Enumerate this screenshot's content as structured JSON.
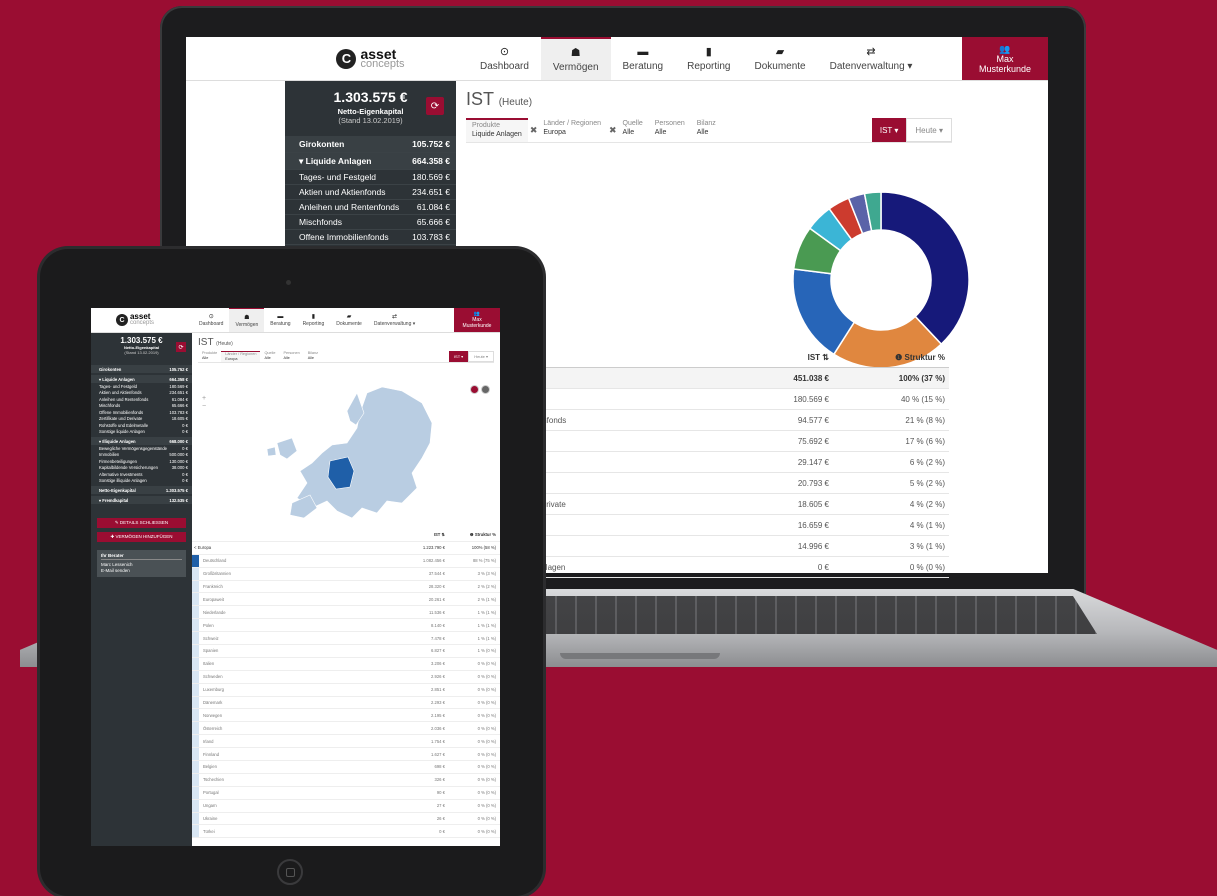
{
  "brand": {
    "name": "asset",
    "sub": "concepts"
  },
  "nav": [
    {
      "icon": "⊙",
      "label": "Dashboard"
    },
    {
      "icon": "☗",
      "label": "Vermögen"
    },
    {
      "icon": "▬",
      "label": "Beratung"
    },
    {
      "icon": "▮",
      "label": "Reporting"
    },
    {
      "icon": "▰",
      "label": "Dokumente"
    },
    {
      "icon": "⇄",
      "label": "Datenverwaltung ▾"
    }
  ],
  "user": {
    "icon": "👥",
    "first": "Max",
    "last": "Musterkunde"
  },
  "kpi": {
    "value": "1.303.575 €",
    "label": "Netto-Eigenkapital",
    "date": "(Stand 13.02.2019)",
    "refresh_icon": "⟳"
  },
  "laptop_sidebar": [
    {
      "label": "Girokonten",
      "value": "105.752 €",
      "type": "group"
    },
    {
      "label": "▾ Liquide Anlagen",
      "value": "664.358 €",
      "type": "group"
    },
    {
      "label": "Tages- und Festgeld",
      "value": "180.569 €"
    },
    {
      "label": "Aktien und Aktienfonds",
      "value": "234.651 €"
    },
    {
      "label": "Anleihen und Rentenfonds",
      "value": "61.084 €"
    },
    {
      "label": "Mischfonds",
      "value": "65.666 €"
    },
    {
      "label": "Offene Immobilienfonds",
      "value": "103.783 €"
    },
    {
      "label": "Zertifikate und Derivate",
      "value": "18.605 €"
    },
    {
      "label": "Rohstoffe und Edelmetalle",
      "value": "0 €"
    },
    {
      "label": "Sonstige liquide Anlagen",
      "value": "0 €"
    }
  ],
  "page": {
    "title": "IST",
    "subtitle": "(Heute)"
  },
  "filters": [
    {
      "label": "Produkte",
      "value": "Liquide Anlagen",
      "active": true,
      "removable": true
    },
    {
      "label": "Länder / Regionen",
      "value": "Europa",
      "active": false,
      "removable": true
    },
    {
      "label": "Quelle",
      "value": "Alle"
    },
    {
      "label": "Personen",
      "value": "Alle"
    },
    {
      "label": "Bilanz",
      "value": "Alle"
    }
  ],
  "ist_button": "IST ▾",
  "heute_button": "Heute ▾",
  "donut": {
    "colors": [
      "#16197a",
      "#e0873f",
      "#2765b8",
      "#4a9a52",
      "#3bb5d6",
      "#cc3b2e",
      "#5a63a8",
      "#3fa890"
    ],
    "values": [
      38,
      21,
      18,
      8,
      5,
      4,
      3,
      3
    ]
  },
  "laptop_table": {
    "headers": {
      "ist": "IST ⇅",
      "struktur": "❶ Struktur %"
    },
    "rows": [
      {
        "name": "",
        "ist": "451.038 €",
        "struktur": "100%  (37 %)",
        "total": true
      },
      {
        "name": "",
        "ist": "180.569 €",
        "struktur": "40 %  (15 %)"
      },
      {
        "name": "ienfonds",
        "ist": "94.577 €",
        "struktur": "21 %  (8 %)"
      },
      {
        "name": "",
        "ist": "75.692 €",
        "struktur": "17 %  (6 %)"
      },
      {
        "name": "",
        "ist": "29.147 €",
        "struktur": "6 %  (2 %)"
      },
      {
        "name": "",
        "ist": "20.793 €",
        "struktur": "5 %  (2 %)"
      },
      {
        "name": "Derivate",
        "ist": "18.605 €",
        "struktur": "4 %  (2 %)"
      },
      {
        "name": "",
        "ist": "16.659 €",
        "struktur": "4 %  (1 %)"
      },
      {
        "name": "",
        "ist": "14.996 €",
        "struktur": "3 %  (1 %)"
      },
      {
        "name": "Anlagen",
        "ist": "0 €",
        "struktur": "0 %  (0 %)"
      }
    ]
  },
  "tablet_sidebar": [
    {
      "label": "Girokonten",
      "value": "105.752 €",
      "type": "group"
    },
    {
      "label": "▾ Liquide Anlagen",
      "value": "664.358 €",
      "type": "group"
    },
    {
      "label": "Tages- und Festgeld",
      "value": "180.569 €"
    },
    {
      "label": "Aktien und Aktienfonds",
      "value": "234.651 €"
    },
    {
      "label": "Anleihen und Rentenfonds",
      "value": "61.084 €"
    },
    {
      "label": "Mischfonds",
      "value": "65.666 €"
    },
    {
      "label": "Offene Immobilienfonds",
      "value": "103.783 €"
    },
    {
      "label": "Zertifikate und Derivate",
      "value": "18.605 €"
    },
    {
      "label": "Rohstoffe und Edelmetalle",
      "value": "0 €"
    },
    {
      "label": "Sonstige liquide Anlagen",
      "value": "0 €"
    },
    {
      "label": "▾ Illiquide Anlagen",
      "value": "668.000 €",
      "type": "group"
    },
    {
      "label": "Bewegliche Vermögensgegenstände",
      "value": "0 €"
    },
    {
      "label": "Immobilien",
      "value": "500.000 €"
    },
    {
      "label": "Firmenbeteiligungen",
      "value": "130.000 €"
    },
    {
      "label": "Kapitalbildende Versicherungen",
      "value": "38.000 €"
    },
    {
      "label": "Alternative Investments",
      "value": "0 €"
    },
    {
      "label": "Sonstige illiquide Anlagen",
      "value": "0 €"
    },
    {
      "label": "Netto-Eigenkapital",
      "value": "1.303.575 €",
      "type": "group"
    },
    {
      "label": "▾ Fremdkapital",
      "value": "132.535 €",
      "type": "group"
    }
  ],
  "tablet_buttons": {
    "close": "✎  DETAILS SCHLIESSEN",
    "add": "✚  VERMÖGEN HINZUFÜGEN"
  },
  "berater": {
    "title": "Ihr Berater",
    "name": "Marc Lessenich",
    "mail": "E-Mail senden"
  },
  "zoom": {
    "in": "+",
    "out": "−"
  },
  "tablet_table": {
    "headers": {
      "ist": "IST ⇅",
      "struktur": "❶ Struktur %"
    },
    "total": {
      "name": "< Europa",
      "ist": "1.223.790 €",
      "struktur": "100%  (58 %)"
    },
    "rows": [
      {
        "name": "Deutschland",
        "ist": "1.082.456 €",
        "struktur": "88 %  (75 %)",
        "sel": true
      },
      {
        "name": "Großbritannien",
        "ist": "37.544 €",
        "struktur": "3 %  (3 %)"
      },
      {
        "name": "Frankreich",
        "ist": "28.320 €",
        "struktur": "2 %  (2 %)"
      },
      {
        "name": "Europaweit",
        "ist": "20.261 €",
        "struktur": "2 %  (1 %)"
      },
      {
        "name": "Niederlande",
        "ist": "11.536 €",
        "struktur": "1 %  (1 %)"
      },
      {
        "name": "Polen",
        "ist": "8.140 €",
        "struktur": "1 %  (1 %)"
      },
      {
        "name": "Schweiz",
        "ist": "7.478 €",
        "struktur": "1 %  (1 %)"
      },
      {
        "name": "Spanien",
        "ist": "6.827 €",
        "struktur": "1 %  (0 %)"
      },
      {
        "name": "Italien",
        "ist": "3.206 €",
        "struktur": "0 %  (0 %)"
      },
      {
        "name": "Schweden",
        "ist": "2.926 €",
        "struktur": "0 %  (0 %)"
      },
      {
        "name": "Luxemburg",
        "ist": "2.851 €",
        "struktur": "0 %  (0 %)"
      },
      {
        "name": "Dänemark",
        "ist": "2.293 €",
        "struktur": "0 %  (0 %)"
      },
      {
        "name": "Norwegen",
        "ist": "2.195 €",
        "struktur": "0 %  (0 %)"
      },
      {
        "name": "Österreich",
        "ist": "2.036 €",
        "struktur": "0 %  (0 %)"
      },
      {
        "name": "Irland",
        "ist": "1.754 €",
        "struktur": "0 %  (0 %)"
      },
      {
        "name": "Finnland",
        "ist": "1.627 €",
        "struktur": "0 %  (0 %)"
      },
      {
        "name": "Belgien",
        "ist": "698 €",
        "struktur": "0 %  (0 %)"
      },
      {
        "name": "Tschechien",
        "ist": "326 €",
        "struktur": "0 %  (0 %)"
      },
      {
        "name": "Portugal",
        "ist": "90 €",
        "struktur": "0 %  (0 %)"
      },
      {
        "name": "Ungarn",
        "ist": "27 €",
        "struktur": "0 %  (0 %)"
      },
      {
        "name": "Ukraine",
        "ist": "26 €",
        "struktur": "0 %  (0 %)"
      },
      {
        "name": "Türkei",
        "ist": "0 €",
        "struktur": "0 %  (0 %)"
      }
    ]
  }
}
